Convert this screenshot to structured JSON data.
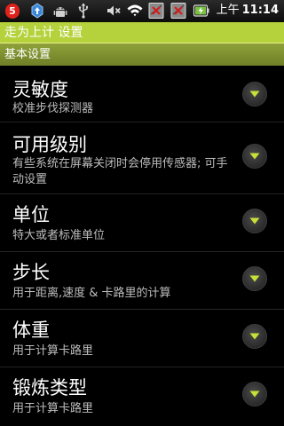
{
  "status_bar": {
    "notification_count": "5",
    "icons": [
      "notification-badge-icon",
      "upload-icon",
      "android-icon",
      "usb-icon",
      "mute-icon",
      "wifi-icon",
      "no-signal-icon",
      "no-signal-icon",
      "battery-charging-icon"
    ],
    "ampm": "上午",
    "time": "11:14"
  },
  "title_bar": {
    "title": "走为上计 设置"
  },
  "section": {
    "header": "基本设置"
  },
  "preferences": [
    {
      "title": "灵敏度",
      "summary": "校准步伐探测器"
    },
    {
      "title": "可用级别",
      "summary": "有些系统在屏幕关闭时会停用传感器; 可手动设置"
    },
    {
      "title": "单位",
      "summary": "特大或者标准单位"
    },
    {
      "title": "步长",
      "summary": "用于距离,速度 & 卡路里的计算"
    },
    {
      "title": "体重",
      "summary": "用于计算卡路里"
    },
    {
      "title": "锻炼类型",
      "summary": "用于计算卡路里"
    }
  ],
  "colors": {
    "title_bar": "#b5d13c",
    "section_header": "#7c8d2e",
    "background": "#000000",
    "notification": "#e0221d",
    "battery": "#7ac143"
  }
}
